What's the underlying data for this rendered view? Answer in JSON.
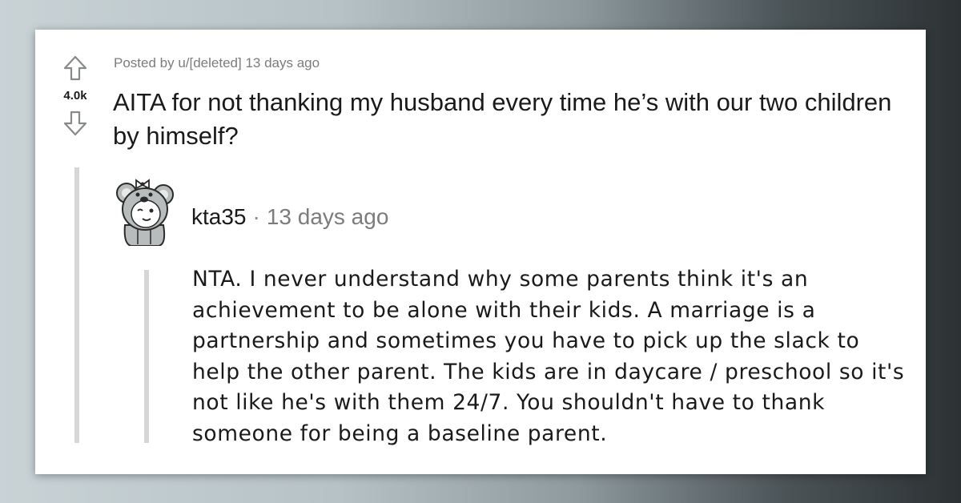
{
  "post": {
    "vote_count": "4.0k",
    "meta": "Posted by u/[deleted] 13 days ago",
    "title": "AITA for not thanking my husband every time he’s with our two children by himself?"
  },
  "comment": {
    "author": "kta35",
    "separator": "·",
    "time": "13 days ago",
    "avatar_icon": "koala-avatar-icon",
    "body": "NTA. I never understand why some parents think it's an achievement to be alone with their kids. A marriage is a partnership and sometimes you have to pick up the slack to help the other parent. The kids are in daycare / preschool so it's not like he's with them 24/7. You shouldn't have to thank someone for being a baseline parent."
  },
  "icons": {
    "upvote": "upvote-arrow-icon",
    "downvote": "downvote-arrow-icon"
  }
}
